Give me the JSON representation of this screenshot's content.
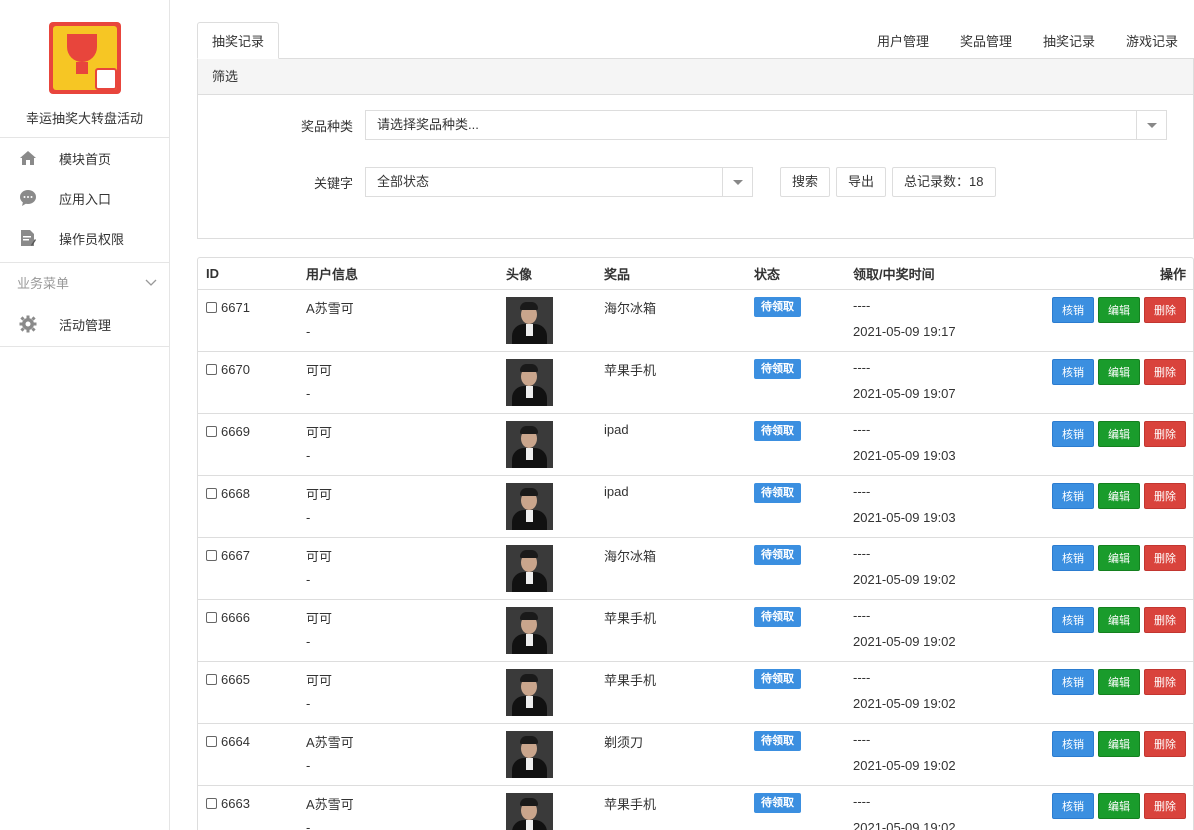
{
  "sidebar": {
    "app_title": "幸运抽奖大转盘活动",
    "items": [
      {
        "label": "模块首页",
        "icon": "home-icon"
      },
      {
        "label": "应用入口",
        "icon": "chat-icon"
      },
      {
        "label": "操作员权限",
        "icon": "document-edit-icon"
      }
    ],
    "group_label": "业务菜单",
    "group_items": [
      {
        "label": "活动管理",
        "icon": "gear-icon"
      }
    ]
  },
  "tabs": {
    "active": "抽奖记录",
    "links": [
      "用户管理",
      "奖品管理",
      "抽奖记录",
      "游戏记录"
    ]
  },
  "filter": {
    "header": "筛选",
    "prize_type_label": "奖品种类",
    "prize_type_placeholder": "请选择奖品种类...",
    "keyword_label": "关键字",
    "status_value": "全部状态",
    "search_button": "搜索",
    "export_button": "导出",
    "total_label": "总记录数：18"
  },
  "table": {
    "headers": {
      "id": "ID",
      "user": "用户信息",
      "avatar": "头像",
      "prize": "奖品",
      "status": "状态",
      "time": "领取/中奖时间",
      "ops": "操作"
    },
    "rows": [
      {
        "id": "6671",
        "user": "A苏雪可",
        "user_sub": "-",
        "prize": "海尔冰箱",
        "status": "待领取",
        "claim": "----",
        "time": "2021-05-09 19:17"
      },
      {
        "id": "6670",
        "user": "可可",
        "user_sub": "-",
        "prize": "苹果手机",
        "status": "待领取",
        "claim": "----",
        "time": "2021-05-09 19:07"
      },
      {
        "id": "6669",
        "user": "可可",
        "user_sub": "-",
        "prize": "ipad",
        "status": "待领取",
        "claim": "----",
        "time": "2021-05-09 19:03"
      },
      {
        "id": "6668",
        "user": "可可",
        "user_sub": "-",
        "prize": "ipad",
        "status": "待领取",
        "claim": "----",
        "time": "2021-05-09 19:03"
      },
      {
        "id": "6667",
        "user": "可可",
        "user_sub": "-",
        "prize": "海尔冰箱",
        "status": "待领取",
        "claim": "----",
        "time": "2021-05-09 19:02"
      },
      {
        "id": "6666",
        "user": "可可",
        "user_sub": "-",
        "prize": "苹果手机",
        "status": "待领取",
        "claim": "----",
        "time": "2021-05-09 19:02"
      },
      {
        "id": "6665",
        "user": "可可",
        "user_sub": "-",
        "prize": "苹果手机",
        "status": "待领取",
        "claim": "----",
        "time": "2021-05-09 19:02"
      },
      {
        "id": "6664",
        "user": "A苏雪可",
        "user_sub": "-",
        "prize": "剃须刀",
        "status": "待领取",
        "claim": "----",
        "time": "2021-05-09 19:02"
      },
      {
        "id": "6663",
        "user": "A苏雪可",
        "user_sub": "-",
        "prize": "苹果手机",
        "status": "待领取",
        "claim": "----",
        "time": "2021-05-09 19:02"
      }
    ],
    "ops": {
      "verify": "核销",
      "edit": "编辑",
      "delete": "删除"
    }
  },
  "colors": {
    "primary": "#3b8fe0",
    "success": "#1a9c2c",
    "danger": "#d9433c",
    "logo_red": "#e8453c",
    "logo_yellow": "#f6c624"
  }
}
